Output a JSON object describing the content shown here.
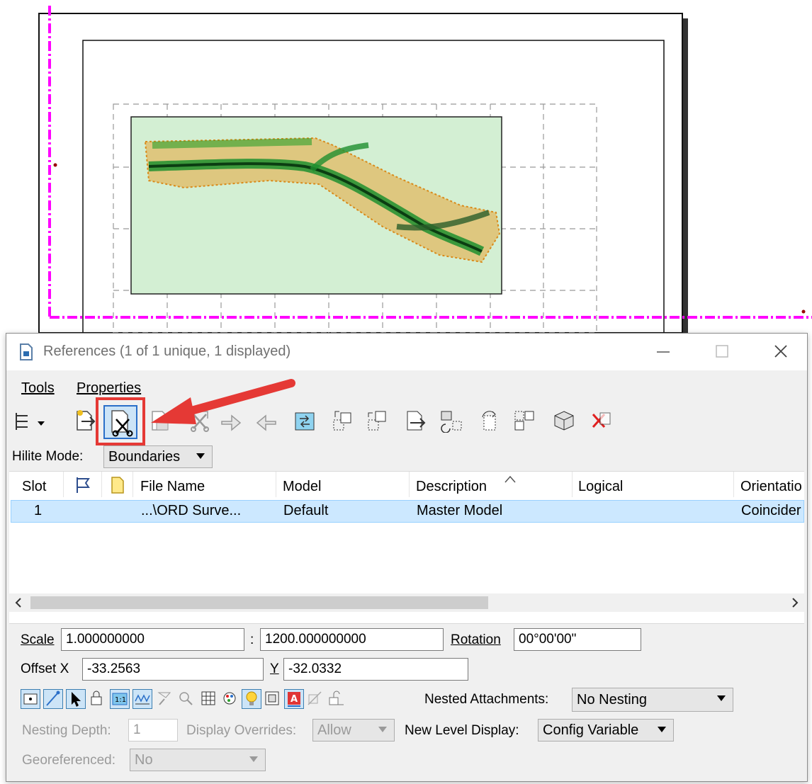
{
  "dialog": {
    "title": "References (1 of 1 unique, 1 displayed)",
    "menus": [
      "Tools",
      "Properties"
    ],
    "hilite_label": "Hilite Mode:",
    "hilite_value": "Boundaries",
    "table": {
      "headers": [
        "Slot",
        "File Name",
        "Model",
        "Description",
        "Logical",
        "Orientatio"
      ],
      "rows": [
        {
          "slot": "1",
          "file": "...\\ORD Surve...",
          "model": "Default",
          "description": "Master Model",
          "logical": "",
          "orientation": "Coincider"
        }
      ]
    },
    "props": {
      "scale_label": "Scale",
      "scale_value": "1.000000000",
      "colon": ":",
      "scale_value2": "1200.000000000",
      "rotation_label": "Rotation",
      "rotation_value": "00°00'00\"",
      "offset_x_label": "Offset X",
      "offset_x_value": "-33.2563",
      "offset_y_label": "Y",
      "offset_y_value": "-32.0332",
      "nested_label": "Nested Attachments:",
      "nested_value": "No Nesting",
      "nesting_depth_label": "Nesting Depth:",
      "nesting_depth_value": "1",
      "display_overrides_label": "Display Overrides:",
      "display_overrides_value": "Allow",
      "new_level_label": "New Level Display:",
      "new_level_value": "Config Variable",
      "georef_label": "Georeferenced:",
      "georef_value": "No"
    }
  },
  "colors": {
    "boundary_magenta": "#ff00ff",
    "highlight_red": "#e53935",
    "selection_blue": "#cce8ff",
    "map_fill": "#d3efd3"
  },
  "icons": [
    "tree-view-icon",
    "attach-reference-icon",
    "clip-boundary-icon",
    "clip-mask-icon",
    "clip-delete-icon",
    "move-icon",
    "copy-icon",
    "scale-icon",
    "rotate-icon",
    "mirror-h-icon",
    "mirror-v-icon",
    "reload-icon",
    "exchange-icon",
    "detach-icon"
  ]
}
